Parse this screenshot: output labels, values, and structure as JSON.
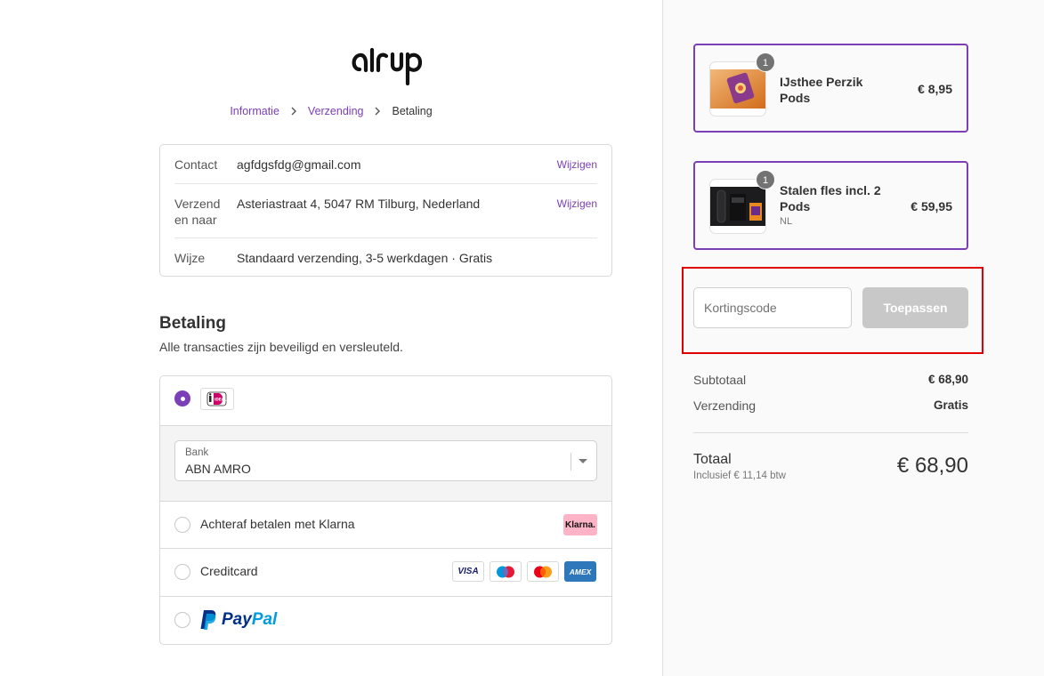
{
  "brand": {
    "logo_text": "air up",
    "accent_color": "#7b3fb7"
  },
  "breadcrumb": [
    {
      "label": "Informatie",
      "state": "link"
    },
    {
      "label": "Verzending",
      "state": "link"
    },
    {
      "label": "Betaling",
      "state": "current"
    }
  ],
  "review": {
    "contact_label": "Contact",
    "contact_value": "agfdgsfdg@gmail.com",
    "ship_to_label_line1": "Verzend",
    "ship_to_label_line2": "en naar",
    "ship_to_value": "Asteriastraat 4, 5047 RM Tilburg, Nederland",
    "method_label": "Wijze",
    "method_value": "Standaard verzending, 3-5 werkdagen · Gratis",
    "change_label": "Wijzigen"
  },
  "payment": {
    "title": "Betaling",
    "subtitle": "Alle transacties zijn beveiligd en versleuteld.",
    "ideal_icon": "ideal-icon",
    "bank_label": "Bank",
    "bank_value": "ABN AMRO",
    "klarna_label": "Achteraf betalen met Klarna",
    "klarna_badge": "Klarna.",
    "creditcard_label": "Creditcard",
    "card_visa": "VISA",
    "card_amex": "AMEX",
    "paypal_pay": "Pay",
    "paypal_pal": "Pal"
  },
  "cart": {
    "items": [
      {
        "name_line1": "IJsthee Perzik",
        "name_line2": "Pods",
        "variant": "",
        "qty": "1",
        "price": "€ 8,95"
      },
      {
        "name_line1": "Stalen fles incl. 2",
        "name_line2": "Pods",
        "variant": "NL",
        "qty": "1",
        "price": "€ 59,95"
      }
    ],
    "discount_placeholder": "Kortingscode",
    "discount_button": "Toepassen",
    "subtotal_label": "Subtotaal",
    "subtotal_value": "€ 68,90",
    "shipping_label": "Verzending",
    "shipping_value": "Gratis",
    "total_label": "Totaal",
    "total_vat": "Inclusief € 11,14 btw",
    "total_value": "€ 68,90"
  }
}
